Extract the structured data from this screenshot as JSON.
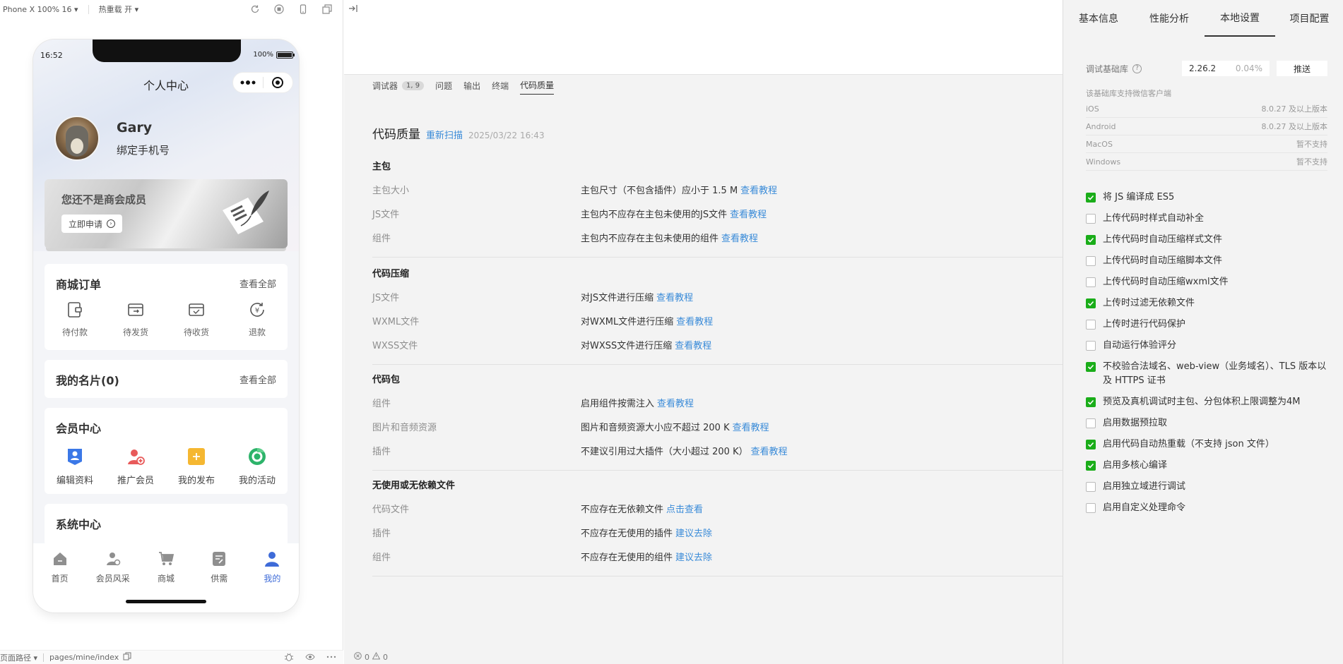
{
  "toolbar": {
    "device": "Phone X 100% 16",
    "hotreload": "热重载 开"
  },
  "phone": {
    "time": "16:52",
    "battery": "100%",
    "nav_title": "个人中心",
    "user_name": "Gary",
    "bind_phone": "绑定手机号",
    "member_title": "您还不是商会成员",
    "member_apply": "立即申请",
    "orders": {
      "title": "商城订单",
      "more": "查看全部",
      "items": [
        {
          "label": "待付款",
          "icon": "wallet-icon"
        },
        {
          "label": "待发货",
          "icon": "shipping-box-icon"
        },
        {
          "label": "待收货",
          "icon": "receive-box-icon"
        },
        {
          "label": "退款",
          "icon": "refund-icon"
        }
      ]
    },
    "cards": {
      "title": "我的名片(0)",
      "more": "查看全部"
    },
    "vip": {
      "title": "会员中心",
      "items": [
        {
          "label": "编辑资料",
          "icon": "edit-profile-icon",
          "color": "#3b78e7"
        },
        {
          "label": "推广会员",
          "icon": "promote-member-icon",
          "color": "#e85a5a"
        },
        {
          "label": "我的发布",
          "icon": "my-publish-icon",
          "color": "#f5b731"
        },
        {
          "label": "我的活动",
          "icon": "my-activity-icon",
          "color": "#2db36a"
        }
      ]
    },
    "system": {
      "title": "系统中心"
    },
    "tabbar": [
      {
        "label": "首页",
        "icon": "home-icon"
      },
      {
        "label": "会员风采",
        "icon": "members-icon"
      },
      {
        "label": "商城",
        "icon": "cart-icon"
      },
      {
        "label": "供需",
        "icon": "supply-demand-icon"
      },
      {
        "label": "我的",
        "icon": "user-icon",
        "active": true
      }
    ]
  },
  "sim_bottom": {
    "path_label": "页面路径",
    "path": "pages/mine/index"
  },
  "devtabs": [
    {
      "label": "调试器",
      "badge": "1, 9"
    },
    {
      "label": "问题"
    },
    {
      "label": "输出"
    },
    {
      "label": "终端"
    },
    {
      "label": "代码质量",
      "active": true
    }
  ],
  "code_quality": {
    "title": "代码质量",
    "rescan": "重新扫描",
    "time": "2025/03/22 16:43",
    "sections": [
      {
        "title": "主包",
        "rows": [
          {
            "k": "主包大小",
            "v": "主包尺寸（不包含插件）应小于 1.5 M",
            "link": "查看教程"
          },
          {
            "k": "JS文件",
            "v": "主包内不应存在主包未使用的JS文件",
            "link": "查看教程"
          },
          {
            "k": "组件",
            "v": "主包内不应存在主包未使用的组件",
            "link": "查看教程"
          }
        ]
      },
      {
        "title": "代码压缩",
        "rows": [
          {
            "k": "JS文件",
            "v": "对JS文件进行压缩",
            "link": "查看教程"
          },
          {
            "k": "WXML文件",
            "v": "对WXML文件进行压缩",
            "link": "查看教程"
          },
          {
            "k": "WXSS文件",
            "v": "对WXSS文件进行压缩",
            "link": "查看教程"
          }
        ]
      },
      {
        "title": "代码包",
        "rows": [
          {
            "k": "组件",
            "v": "启用组件按需注入",
            "link": "查看教程"
          },
          {
            "k": "图片和音频资源",
            "v": "图片和音频资源大小应不超过 200 K",
            "link": "查看教程"
          },
          {
            "k": "插件",
            "v": "不建议引用过大插件（大小超过 200 K）",
            "link": "查看教程"
          }
        ]
      },
      {
        "title": "无使用或无依赖文件",
        "rows": [
          {
            "k": "代码文件",
            "v": "不应存在无依赖文件",
            "link": "点击查看"
          },
          {
            "k": "插件",
            "v": "不应存在无使用的插件",
            "link": "建议去除"
          },
          {
            "k": "组件",
            "v": "不应存在无使用的组件",
            "link": "建议去除"
          }
        ]
      }
    ]
  },
  "center_bottom": {
    "errors": "0",
    "warnings": "0"
  },
  "right_tabs": [
    {
      "label": "基本信息"
    },
    {
      "label": "性能分析"
    },
    {
      "label": "本地设置",
      "active": true
    },
    {
      "label": "项目配置"
    }
  ],
  "local_settings": {
    "lib_label": "调试基础库",
    "lib_version": "2.26.2",
    "lib_pct": "0.04%",
    "push_label": "推送",
    "support_note": "该基础库支持微信客户端",
    "support": [
      {
        "os": "iOS",
        "ver": "8.0.27 及以上版本"
      },
      {
        "os": "Android",
        "ver": "8.0.27 及以上版本"
      },
      {
        "os": "MacOS",
        "ver": "暂不支持"
      },
      {
        "os": "Windows",
        "ver": "暂不支持"
      }
    ],
    "options": [
      {
        "label": "将 JS 编译成 ES5",
        "checked": true
      },
      {
        "label": "上传代码时样式自动补全",
        "checked": false
      },
      {
        "label": "上传代码时自动压缩样式文件",
        "checked": true
      },
      {
        "label": "上传代码时自动压缩脚本文件",
        "checked": false
      },
      {
        "label": "上传代码时自动压缩wxml文件",
        "checked": false
      },
      {
        "label": "上传时过滤无依赖文件",
        "checked": true
      },
      {
        "label": "上传时进行代码保护",
        "checked": false
      },
      {
        "label": "自动运行体验评分",
        "checked": false
      },
      {
        "label": "不校验合法域名、web-view（业务域名）、TLS 版本以及 HTTPS 证书",
        "checked": true
      },
      {
        "label": "预览及真机调试时主包、分包体积上限调整为4M",
        "checked": true
      },
      {
        "label": "启用数据预拉取",
        "checked": false
      },
      {
        "label": "启用代码自动热重载（不支持 json 文件）",
        "checked": true
      },
      {
        "label": "启用多核心编译",
        "checked": true
      },
      {
        "label": "启用独立域进行调试",
        "checked": false
      },
      {
        "label": "启用自定义处理命令",
        "checked": false
      }
    ]
  }
}
